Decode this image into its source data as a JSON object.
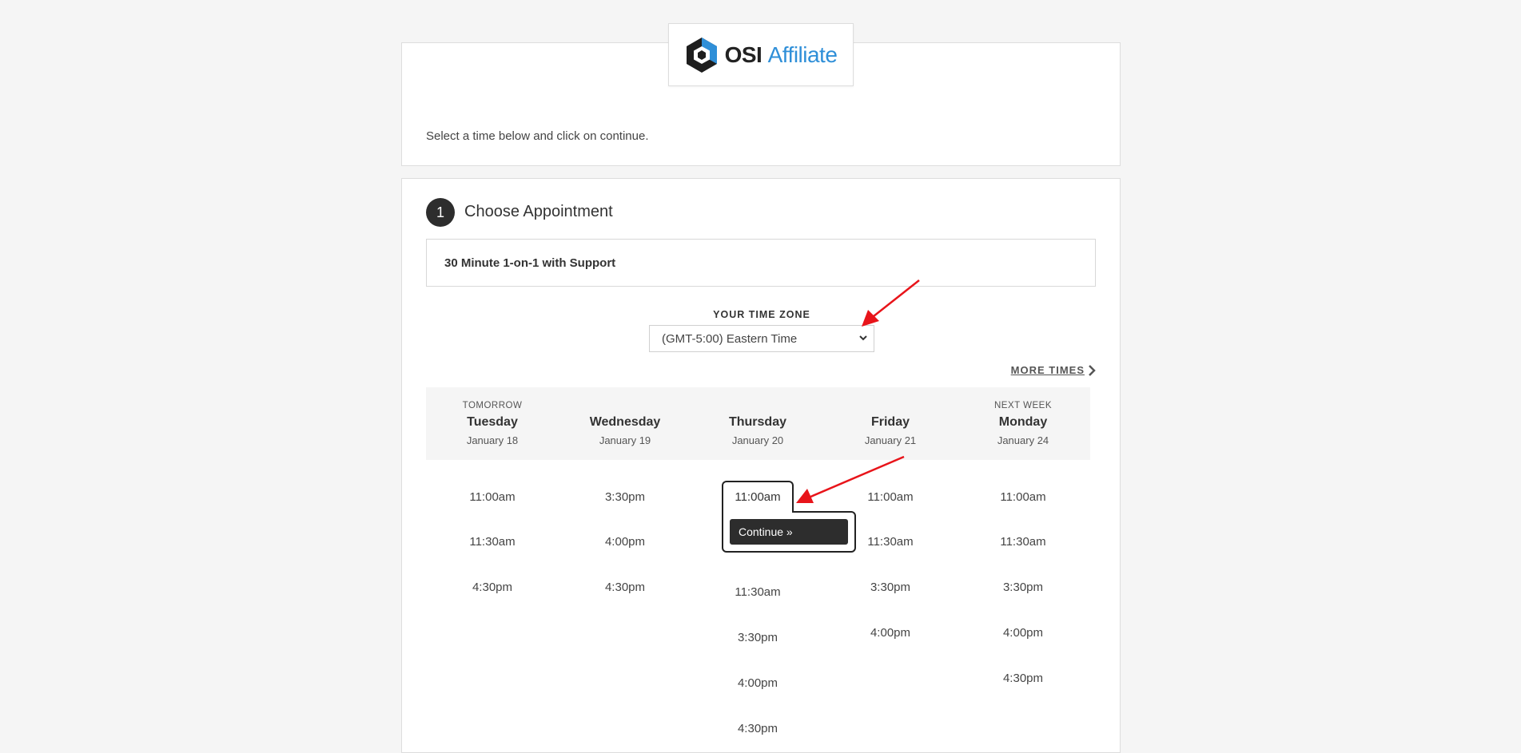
{
  "logo": {
    "part1": "OSI",
    "part2": "Affiliate"
  },
  "intro": {
    "text": "Select a time below and click on continue."
  },
  "step": {
    "number": "1",
    "title": "Choose Appointment"
  },
  "appointment_type": "30 Minute 1-on-1 with Support",
  "timezone": {
    "label": "YOUR TIME ZONE",
    "selected": "(GMT-5:00) Eastern Time"
  },
  "more_times": "MORE TIMES",
  "days": [
    {
      "sub": "TOMORROW",
      "name": "Tuesday",
      "date": "January 18",
      "times": [
        "11:00am",
        "11:30am",
        "4:30pm"
      ]
    },
    {
      "sub": "",
      "name": "Wednesday",
      "date": "January 19",
      "times": [
        "3:30pm",
        "4:00pm",
        "4:30pm"
      ]
    },
    {
      "sub": "",
      "name": "Thursday",
      "date": "January 20",
      "times": [
        "11:00am",
        "11:30am",
        "3:30pm",
        "4:00pm",
        "4:30pm"
      ]
    },
    {
      "sub": "",
      "name": "Friday",
      "date": "January 21",
      "times": [
        "11:00am",
        "11:30am",
        "3:30pm",
        "4:00pm"
      ]
    },
    {
      "sub": "NEXT WEEK",
      "name": "Monday",
      "date": "January 24",
      "times": [
        "11:00am",
        "11:30am",
        "3:30pm",
        "4:00pm",
        "4:30pm"
      ]
    }
  ],
  "selected": {
    "time": "11:00am",
    "button": "Continue »"
  },
  "colors": {
    "accent": "#2f8fd8",
    "dark": "#2d2d2d",
    "annotation": "#e8141a"
  }
}
